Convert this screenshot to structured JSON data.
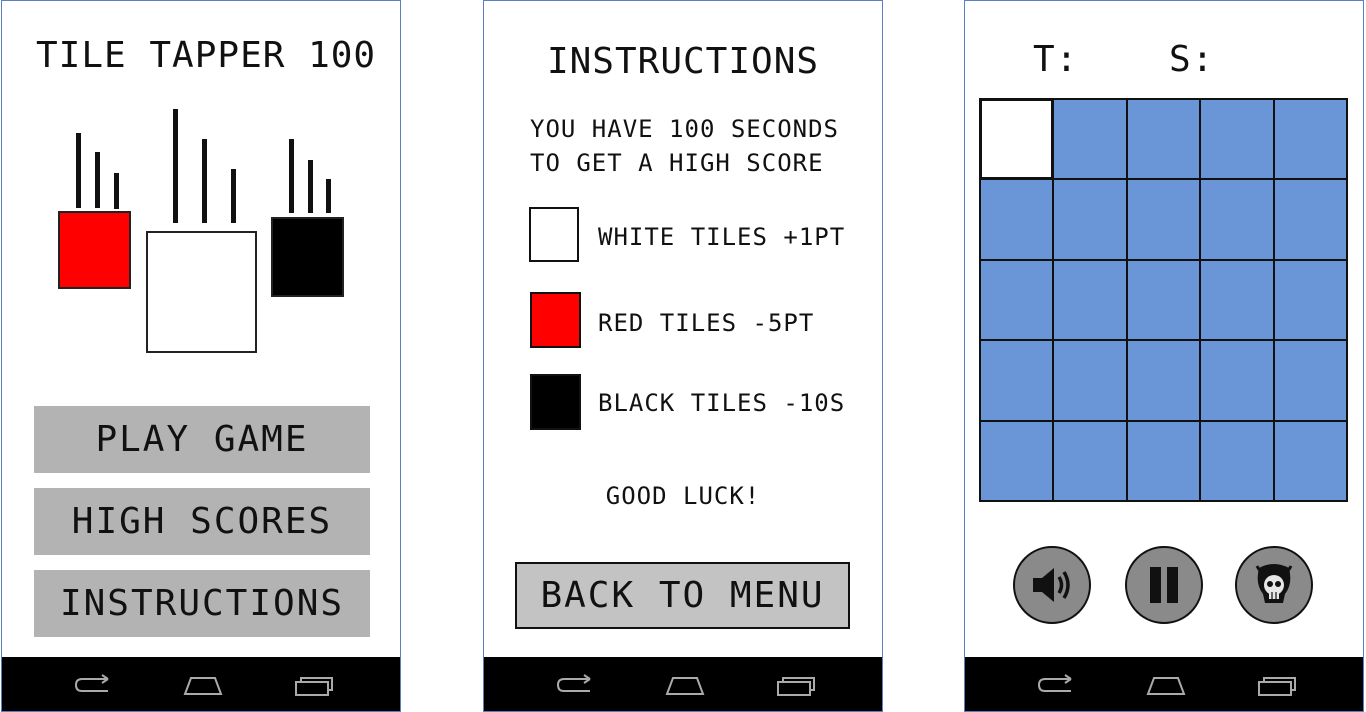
{
  "menu": {
    "title": "TILE TAPPER 100",
    "logo_colors": {
      "red": "#ff0000",
      "white": "#ffffff",
      "black": "#000000"
    },
    "buttons": [
      "PLAY GAME",
      "HIGH SCORES",
      "INSTRUCTIONS"
    ]
  },
  "instructions": {
    "title": "INSTRUCTIONS",
    "intro_line_1": "YOU HAVE 100 SECONDS",
    "intro_line_2": "TO GET A HIGH SCORE",
    "rules": [
      {
        "label": "WHITE TILES +1PT",
        "color": "#ffffff"
      },
      {
        "label": "RED TILES -5PT",
        "color": "#ff0000"
      },
      {
        "label": "BLACK TILES -10S",
        "color": "#000000"
      }
    ],
    "good_luck": "GOOD LUCK!",
    "back_button": "BACK TO MENU"
  },
  "game": {
    "time_label": "T:",
    "score_label": "S:",
    "grid_rows": 5,
    "grid_cols": 5,
    "tile_color": "#6a96d8",
    "white_tile_index": 0,
    "controls": [
      "speaker-icon",
      "pause-icon",
      "skull-icon"
    ]
  },
  "navbar_icons": [
    "back-icon",
    "home-icon",
    "recents-icon"
  ]
}
